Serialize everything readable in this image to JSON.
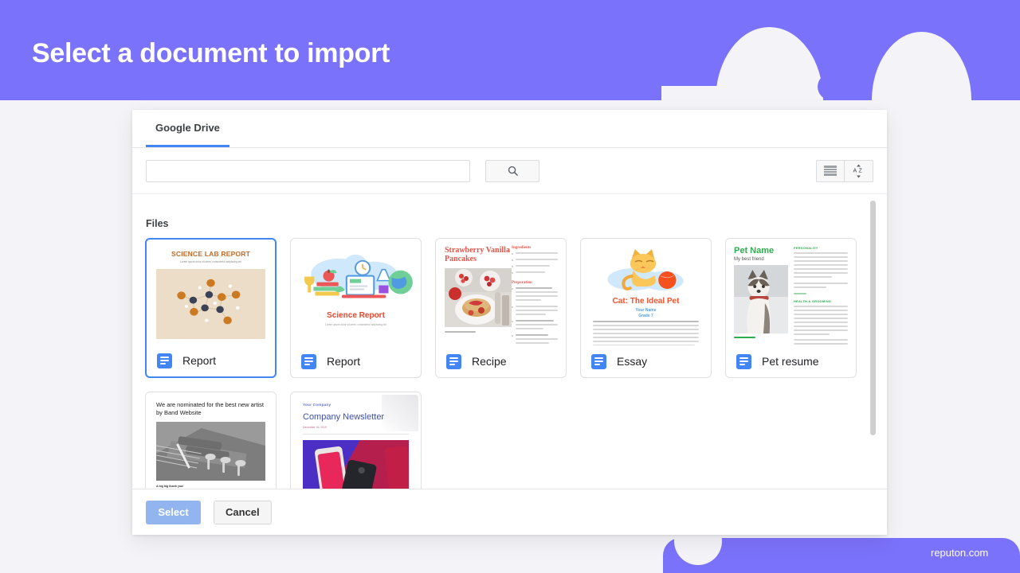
{
  "page": {
    "title": "Select a document to import",
    "accent_purple": "#7b72fb",
    "background": "#f4f4f8",
    "watermark": "reputon.com"
  },
  "modal": {
    "tabs": [
      {
        "label": "Google Drive",
        "active": true
      }
    ],
    "search": {
      "value": "",
      "placeholder": ""
    },
    "toolbar": {
      "search_button_icon": "search-icon",
      "list_view_icon": "list-view-icon",
      "sort_az_icon": "sort-az-icon",
      "sort_az_label": "A Z"
    },
    "section_label": "Files",
    "files": [
      {
        "name": "Report",
        "icon": "google-docs-icon",
        "selected": true,
        "thumb": {
          "kind": "science-lab-report",
          "title": "SCIENCE LAB REPORT",
          "subtitle": "Lorem ipsum dolor sit amet, consectetur adipiscing elit"
        }
      },
      {
        "name": "Report",
        "icon": "google-docs-icon",
        "selected": false,
        "thumb": {
          "kind": "science-report",
          "title": "Science Report",
          "subtitle": "Lorem ipsum dolor sit amet, consectetur adipiscing elit"
        }
      },
      {
        "name": "Recipe",
        "icon": "google-docs-icon",
        "selected": false,
        "thumb": {
          "kind": "recipe",
          "title": "Strawberry Vanilla Pancakes",
          "heading_1": "Ingredients",
          "heading_2": "Preparation",
          "caption": "Recipe by Your name"
        }
      },
      {
        "name": "Essay",
        "icon": "google-docs-icon",
        "selected": false,
        "thumb": {
          "kind": "cat-essay",
          "title": "Cat: The Ideal Pet",
          "author": "Your Name",
          "grade": "Grade 7"
        }
      },
      {
        "name": "Pet resume",
        "icon": "google-docs-icon",
        "selected": false,
        "thumb": {
          "kind": "pet-resume",
          "title": "Pet Name",
          "subtitle": "My best friend",
          "heading_1": "PERSONALITY",
          "heading_2": "HEALTH & GROOMING"
        }
      },
      {
        "name": "",
        "icon": "google-docs-icon",
        "selected": false,
        "thumb": {
          "kind": "band-news",
          "title": "We are nominated for the best new artist by Band Website",
          "caption": "A big big thank you!"
        }
      },
      {
        "name": "",
        "icon": "google-docs-icon",
        "selected": false,
        "thumb": {
          "kind": "company-newsletter",
          "company": "Your Company",
          "title": "Company Newsletter",
          "date": "December 16, 2019"
        }
      }
    ],
    "actions": {
      "select_label": "Select",
      "cancel_label": "Cancel"
    }
  }
}
